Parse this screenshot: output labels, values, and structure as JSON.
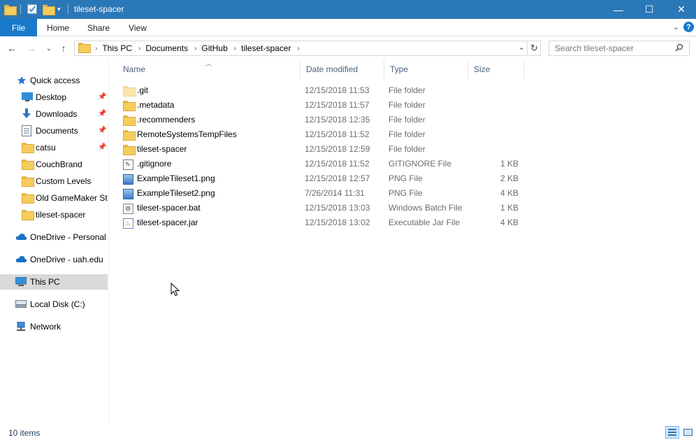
{
  "window": {
    "title": "tileset-spacer",
    "controls": {
      "minimize": "—",
      "maximize": "☐",
      "close": "✕"
    }
  },
  "ribbon": {
    "tabs": [
      "File",
      "Home",
      "Share",
      "View"
    ],
    "help": "?"
  },
  "address": {
    "breadcrumbs": [
      "This PC",
      "Documents",
      "GitHub",
      "tileset-spacer"
    ],
    "search_placeholder": "Search tileset-spacer"
  },
  "sidebar": {
    "quick_access": "Quick access",
    "items": [
      {
        "label": "Desktop",
        "icon": "desktop-icon",
        "pinned": true
      },
      {
        "label": "Downloads",
        "icon": "download-icon",
        "pinned": true
      },
      {
        "label": "Documents",
        "icon": "documents-icon",
        "pinned": true
      },
      {
        "label": "catsu",
        "icon": "folder-icon",
        "pinned": true
      },
      {
        "label": "CouchBrand",
        "icon": "folder-icon",
        "pinned": false
      },
      {
        "label": "Custom Levels",
        "icon": "folder-icon",
        "pinned": false
      },
      {
        "label": "Old GameMaker Stu",
        "icon": "folder-icon",
        "pinned": false
      },
      {
        "label": "tileset-spacer",
        "icon": "folder-icon",
        "pinned": false
      }
    ],
    "onedrive_personal": "OneDrive - Personal",
    "onedrive_uah": "OneDrive - uah.edu",
    "this_pc": "This PC",
    "local_disk": "Local Disk (C:)",
    "network": "Network"
  },
  "columns": {
    "name": "Name",
    "date": "Date modified",
    "type": "Type",
    "size": "Size"
  },
  "files": [
    {
      "name": ".git",
      "date": "12/15/2018 11:53",
      "type": "File folder",
      "size": "",
      "kind": "folder",
      "faded": true
    },
    {
      "name": ".metadata",
      "date": "12/15/2018 11:57",
      "type": "File folder",
      "size": "",
      "kind": "folder",
      "faded": false
    },
    {
      "name": ".recommenders",
      "date": "12/15/2018 12:35",
      "type": "File folder",
      "size": "",
      "kind": "folder",
      "faded": false
    },
    {
      "name": "RemoteSystemsTempFiles",
      "date": "12/15/2018 11:52",
      "type": "File folder",
      "size": "",
      "kind": "folder",
      "faded": false
    },
    {
      "name": "tileset-spacer",
      "date": "12/15/2018 12:59",
      "type": "File folder",
      "size": "",
      "kind": "folder",
      "faded": false
    },
    {
      "name": ".gitignore",
      "date": "12/15/2018 11:52",
      "type": "GITIGNORE File",
      "size": "1 KB",
      "kind": "git",
      "faded": false
    },
    {
      "name": "ExampleTileset1.png",
      "date": "12/15/2018 12:57",
      "type": "PNG File",
      "size": "2 KB",
      "kind": "png",
      "faded": false
    },
    {
      "name": "ExampleTileset2.png",
      "date": "7/26/2014 11:31",
      "type": "PNG File",
      "size": "4 KB",
      "kind": "png",
      "faded": false
    },
    {
      "name": "tileset-spacer.bat",
      "date": "12/15/2018 13:03",
      "type": "Windows Batch File",
      "size": "1 KB",
      "kind": "bat",
      "faded": false
    },
    {
      "name": "tileset-spacer.jar",
      "date": "12/15/2018 13:02",
      "type": "Executable Jar File",
      "size": "4 KB",
      "kind": "jar",
      "faded": false
    }
  ],
  "status": {
    "item_count": "10 items"
  },
  "colors": {
    "titlebar": "#2b78b8",
    "file_tab": "#1979ca",
    "selected_nav": "#d9d9d9"
  }
}
